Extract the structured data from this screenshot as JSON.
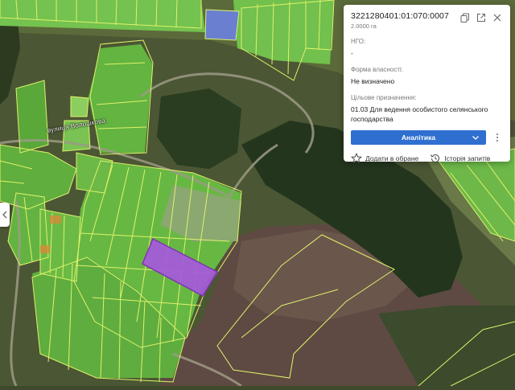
{
  "map": {
    "street_label": "вулиця Волошкова",
    "colors": {
      "selected_parcel": "#a55cd8",
      "selected_parcel_outline": "#7e2fb4",
      "blue_parcel": "#6a7fd0",
      "parcel_outline": "#dff26a",
      "farmland": "#6fc04c"
    }
  },
  "panel": {
    "cadastral_number": "3221280401:01:070:0007",
    "area": "2.0000 га",
    "ngo_label": "НГО:",
    "ngo_value": "-",
    "ownership_label": "Форма власності:",
    "ownership_value": "Не визначено",
    "purpose_label": "Цільове призначення:",
    "purpose_value": "01.03 Для ведення особистого селянського господарства",
    "analytics_button": "Аналітика",
    "add_favorite": "Додати в обране",
    "request_history": "Історія запитів",
    "icons": [
      "copy-icon",
      "external-link-icon",
      "close-icon",
      "chevron-down-icon",
      "more-vertical-icon",
      "star-icon",
      "history-icon",
      "chevron-left-icon"
    ]
  }
}
